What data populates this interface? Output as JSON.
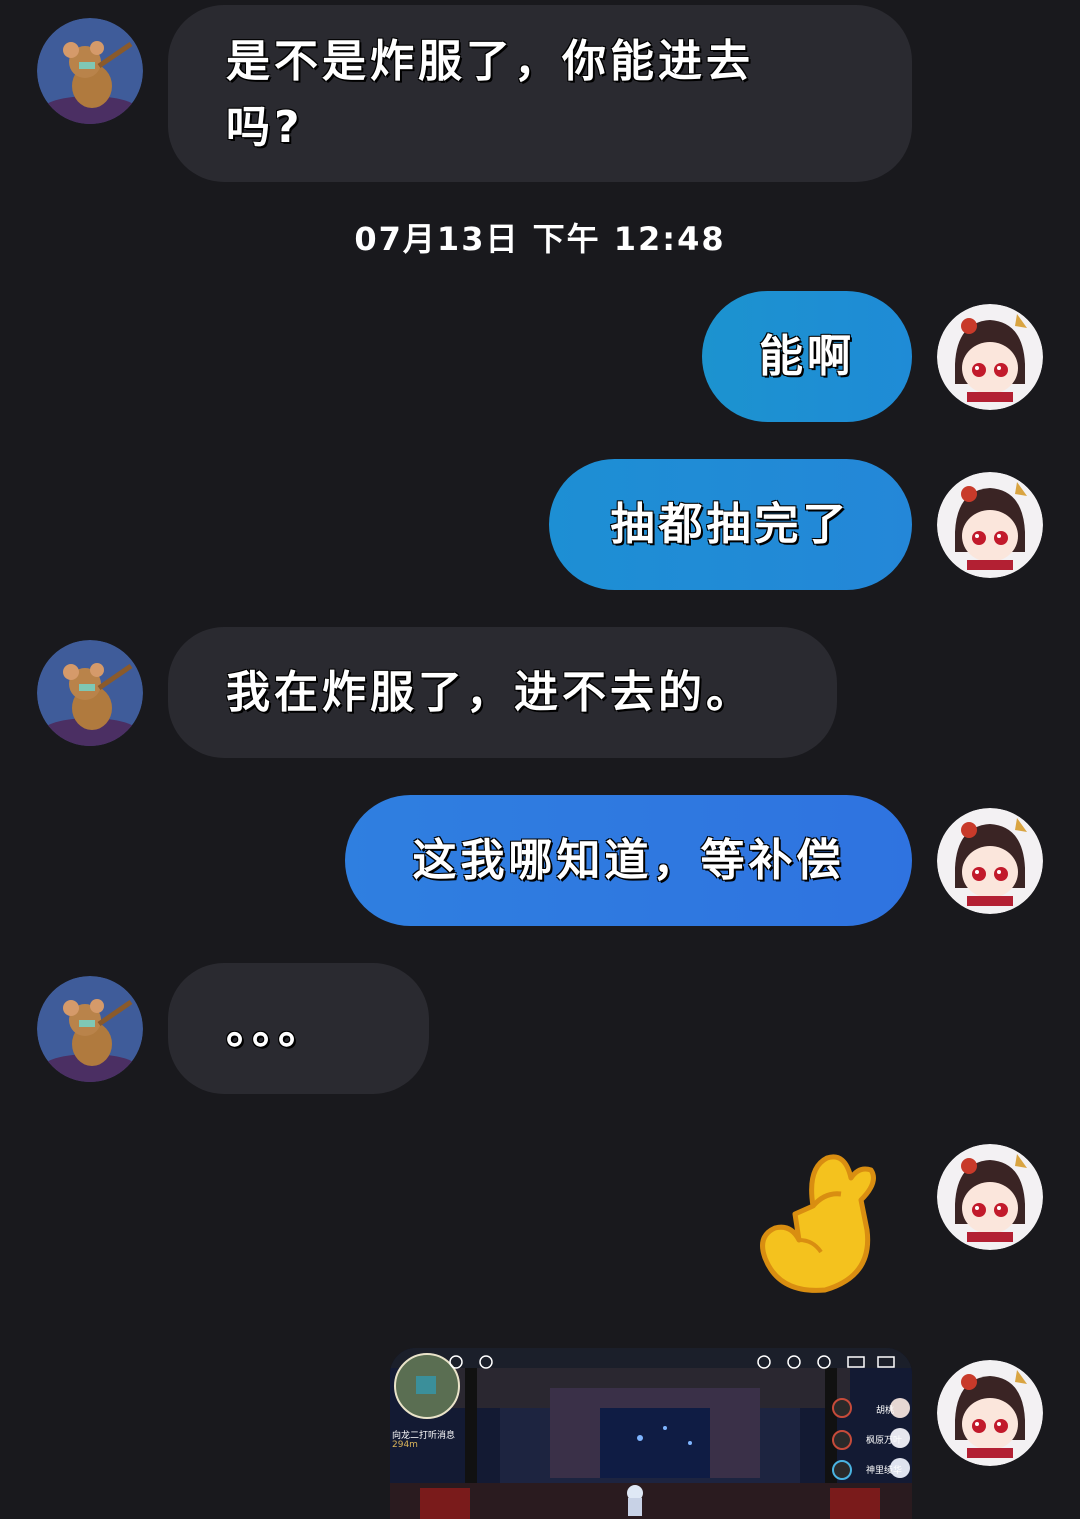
{
  "messages": [
    {
      "side": "in",
      "text": "是不是炸服了，你能进去吗?"
    },
    {
      "side": "out",
      "text": "能啊"
    },
    {
      "side": "out",
      "text": "抽都抽完了"
    },
    {
      "side": "in",
      "text": "我在炸服了，进不去的。"
    },
    {
      "side": "out",
      "text": "这我哪知道，等补偿"
    },
    {
      "side": "in",
      "text": "。。。"
    },
    {
      "side": "out",
      "type": "emoji",
      "icon": "pinched-fingers-emoji"
    },
    {
      "side": "out",
      "type": "image",
      "description_labels": {
        "quest": "向龙二打听消息",
        "distance": "294m",
        "party_1": "胡桃",
        "party_2": "枫原万叶",
        "party_3": "神里绫华"
      }
    }
  ],
  "timestamp": "07月13日 下午 12:48",
  "line1": "是不是炸服了，你能进去",
  "line2": "吗?",
  "colors": {
    "background": "#19191d",
    "incoming_bubble": "#2a2a30",
    "outgoing_gradient_start": "#1d8fd4",
    "outgoing_gradient_end": "#2f6fe0"
  }
}
